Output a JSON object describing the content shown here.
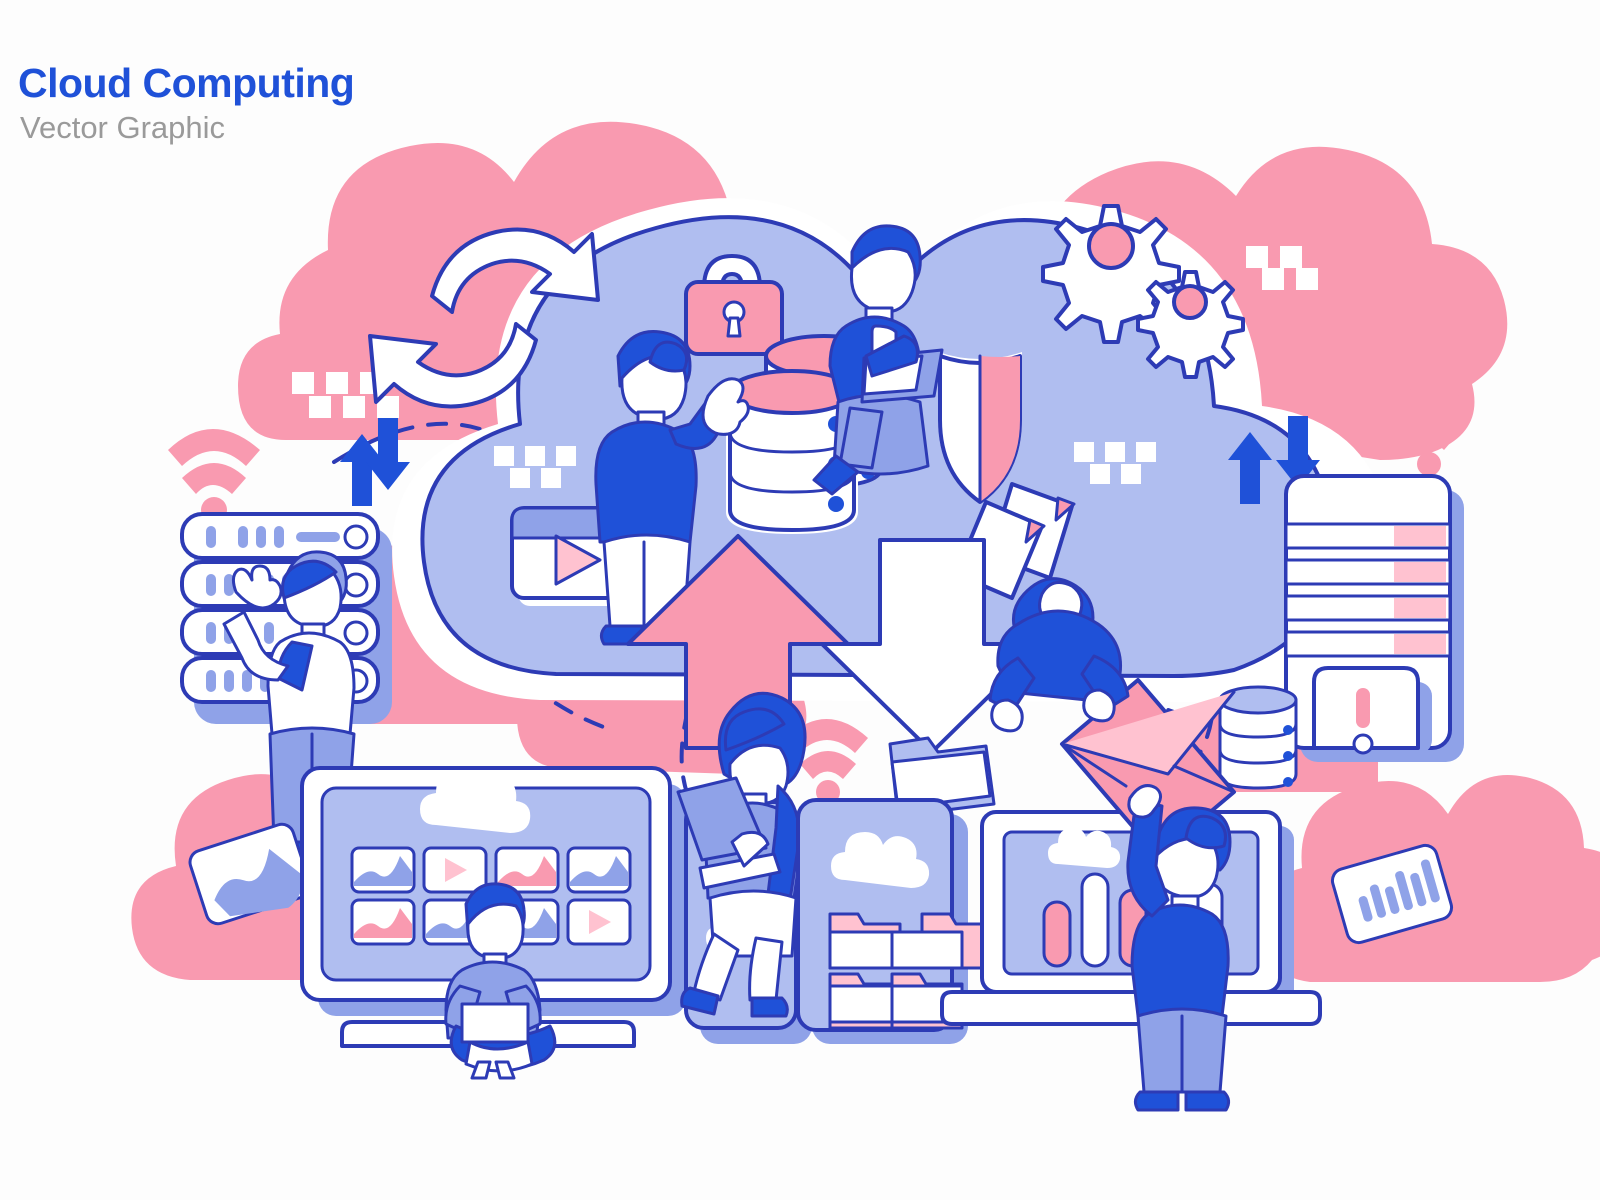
{
  "header": {
    "title": "Cloud Computing",
    "subtitle": "Vector Graphic",
    "title_color": "#1f51d8",
    "subtitle_color": "#9a9a9a"
  },
  "palette": {
    "background": "#ffffff",
    "stroke_blue": "#2d3bb5",
    "accent_blue": "#1f51d8",
    "lavender": "#b0bef0",
    "lavender_deep": "#8fa2e8",
    "pink": "#f99ab0",
    "pink_light": "#ffc2d0",
    "white": "#ffffff",
    "gray_text": "#9a9a9a"
  },
  "scene": {
    "name": "cloud-computing-illustration",
    "description": "Flat-line vector illustration of cloud computing with a large lavender cloud, pink background clouds, upload and download arrows, servers, devices and people.",
    "clouds": [
      {
        "name": "pink-cloud-top-left",
        "color": "#f99ab0"
      },
      {
        "name": "pink-cloud-top-right",
        "color": "#f99ab0"
      },
      {
        "name": "main-cloud",
        "color": "#b0bef0"
      },
      {
        "name": "pink-cloud-mid-left",
        "color": "#f99ab0"
      },
      {
        "name": "pink-cloud-bottom-left",
        "color": "#f99ab0"
      },
      {
        "name": "pink-cloud-bottom-right",
        "color": "#f99ab0"
      },
      {
        "name": "pink-cloud-center-low",
        "color": "#f99ab0"
      },
      {
        "name": "pink-cloud-right-small",
        "color": "#f99ab0"
      }
    ],
    "icons": [
      {
        "name": "sync-arrows-icon",
        "label": "Sync",
        "color": "#ffffff"
      },
      {
        "name": "padlock-icon",
        "label": "Security lock",
        "color": "#f99ab0"
      },
      {
        "name": "shield-icon",
        "label": "Protection shield",
        "color": "#f99ab0"
      },
      {
        "name": "gear-large-icon",
        "label": "Settings",
        "color": "#ffffff"
      },
      {
        "name": "gear-small-icon",
        "label": "Settings",
        "color": "#ffffff"
      },
      {
        "name": "documents-icon",
        "label": "Documents",
        "color": "#ffffff"
      },
      {
        "name": "video-player-icon",
        "label": "Media player",
        "color": "#ffffff"
      },
      {
        "name": "database-stack-icon",
        "label": "Database",
        "color": "#f99ab0"
      },
      {
        "name": "upload-arrow-icon",
        "label": "Upload",
        "color": "#f99ab0"
      },
      {
        "name": "download-arrow-icon",
        "label": "Download",
        "color": "#ffffff"
      },
      {
        "name": "folder-icon",
        "label": "Folder",
        "color": "#b0bef0"
      },
      {
        "name": "envelope-icon",
        "label": "Email",
        "color": "#f99ab0"
      },
      {
        "name": "wifi-icon-left",
        "label": "Wireless",
        "color": "#f99ab0"
      },
      {
        "name": "wifi-icon-center",
        "label": "Wireless",
        "color": "#f99ab0"
      },
      {
        "name": "wifi-icon-right",
        "label": "Wireless",
        "color": "#f99ab0"
      },
      {
        "name": "transfer-arrows-left-icon",
        "label": "Data transfer",
        "color": "#1f51d8"
      },
      {
        "name": "transfer-arrows-right-icon",
        "label": "Data transfer",
        "color": "#1f51d8"
      },
      {
        "name": "photo-card-icon",
        "label": "Image file",
        "color": "#8fa2e8"
      },
      {
        "name": "chart-card-icon",
        "label": "Analytics file",
        "color": "#8fa2e8"
      },
      {
        "name": "alert-server-icon",
        "label": "Server alert",
        "color": "#f99ab0"
      }
    ],
    "devices": [
      {
        "name": "server-rack",
        "units": 4,
        "label": "Server rack"
      },
      {
        "name": "server-tower",
        "slots": 4,
        "label": "Server tower"
      },
      {
        "name": "desktop-monitor",
        "tiles": 8,
        "label": "Desktop monitor"
      },
      {
        "name": "smartphone",
        "label": "Smartphone"
      },
      {
        "name": "tablet",
        "folders": 4,
        "label": "Tablet"
      },
      {
        "name": "laptop",
        "bars": 5,
        "label": "Laptop"
      }
    ],
    "people": [
      {
        "name": "person-pointing-in-cloud",
        "pose": "standing on video card, pointing"
      },
      {
        "name": "person-on-database",
        "pose": "sitting on database with laptop"
      },
      {
        "name": "technician-at-rack",
        "pose": "standing, pointing at server rack"
      },
      {
        "name": "person-on-monitor",
        "pose": "sitting cross-legged with laptop"
      },
      {
        "name": "woman-on-phone",
        "pose": "sitting on smartphone with laptop"
      },
      {
        "name": "person-sending-mail",
        "pose": "leaning, handing envelope"
      },
      {
        "name": "person-receiving-mail",
        "pose": "standing on laptop, reaching up"
      }
    ],
    "monitor_tiles": [
      {
        "name": "tile-image-1",
        "type": "image",
        "color": "#8fa2e8"
      },
      {
        "name": "tile-video-1",
        "type": "video",
        "color": "#f99ab0"
      },
      {
        "name": "tile-image-2",
        "type": "image",
        "color": "#f99ab0"
      },
      {
        "name": "tile-image-3",
        "type": "image",
        "color": "#8fa2e8"
      },
      {
        "name": "tile-image-4",
        "type": "image",
        "color": "#f99ab0"
      },
      {
        "name": "tile-image-5",
        "type": "image",
        "color": "#8fa2e8"
      },
      {
        "name": "tile-image-6",
        "type": "image",
        "color": "#8fa2e8"
      },
      {
        "name": "tile-video-2",
        "type": "video",
        "color": "#f99ab0"
      }
    ],
    "laptop_bars": [
      {
        "name": "bar-1",
        "color": "#f99ab0",
        "height": 0.45
      },
      {
        "name": "bar-2",
        "color": "#ffffff",
        "height": 0.72
      },
      {
        "name": "bar-3",
        "color": "#f99ab0",
        "height": 0.62
      },
      {
        "name": "bar-4",
        "color": "#ffffff",
        "height": 0.8
      },
      {
        "name": "bar-5",
        "color": "#ffffff",
        "height": 0.66
      }
    ],
    "chart_card_bars": [
      0.45,
      0.62,
      0.52,
      0.78,
      0.66,
      0.85,
      0.72
    ]
  }
}
